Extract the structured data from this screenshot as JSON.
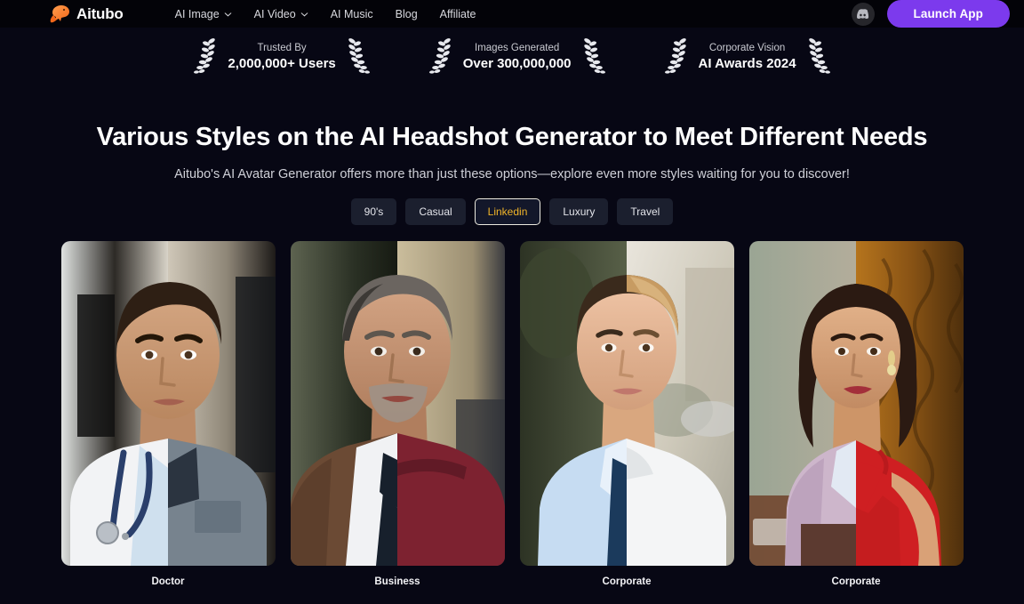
{
  "header": {
    "brand": "Aitubo",
    "logo_icon": "capybara-logo",
    "nav": [
      {
        "label": "AI Image",
        "has_dropdown": true
      },
      {
        "label": "AI Video",
        "has_dropdown": true
      },
      {
        "label": "AI Music",
        "has_dropdown": false
      },
      {
        "label": "Blog",
        "has_dropdown": false
      },
      {
        "label": "Affiliate",
        "has_dropdown": false
      }
    ],
    "discord_icon": "discord-icon",
    "launch_label": "Launch App",
    "launch_color": "#7c3aed"
  },
  "stats": [
    {
      "label": "Trusted By",
      "value": "2,000,000+ Users"
    },
    {
      "label": "Images Generated",
      "value": "Over 300,000,000"
    },
    {
      "label": "Corporate Vision",
      "value": "AI Awards 2024"
    }
  ],
  "hero": {
    "title": "Various Styles on the AI Headshot Generator to Meet Different Needs",
    "subtitle": "Aitubo's AI Avatar Generator offers more than just these options—explore even more styles waiting for you to discover!"
  },
  "pills": [
    {
      "label": "90's",
      "active": false
    },
    {
      "label": "Casual",
      "active": false
    },
    {
      "label": "Linkedin",
      "active": true
    },
    {
      "label": "Luxury",
      "active": false
    },
    {
      "label": "Travel",
      "active": false
    }
  ],
  "active_pill_text_color": "#f0b429",
  "cards": [
    {
      "label": "Doctor"
    },
    {
      "label": "Business"
    },
    {
      "label": "Corporate"
    },
    {
      "label": "Corporate"
    }
  ]
}
